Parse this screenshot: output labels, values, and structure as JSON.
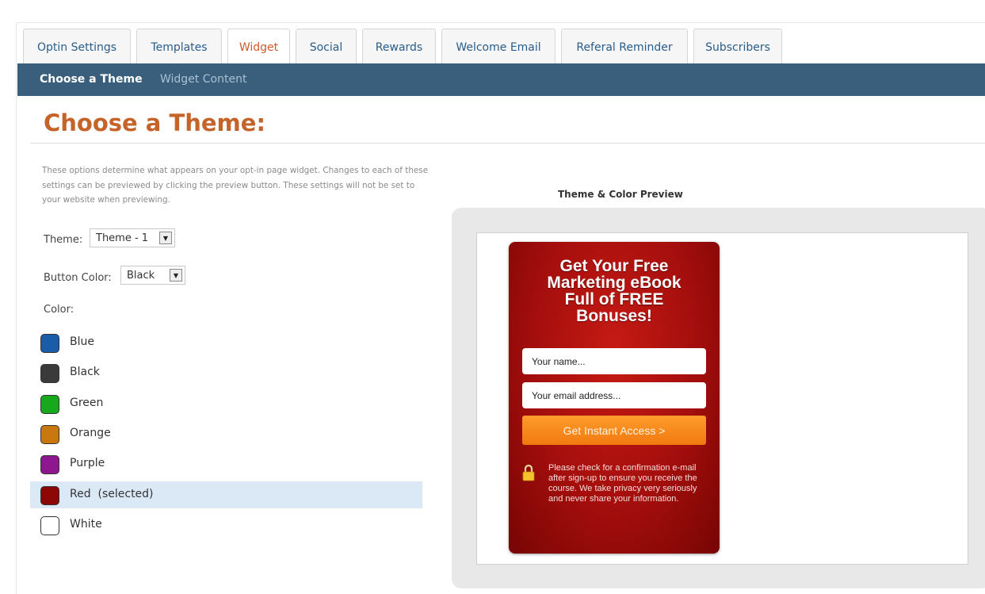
{
  "tabs": [
    {
      "label": "Optin Settings",
      "active": false
    },
    {
      "label": "Templates",
      "active": false
    },
    {
      "label": "Widget",
      "active": true
    },
    {
      "label": "Social",
      "active": false
    },
    {
      "label": "Rewards",
      "active": false
    },
    {
      "label": "Welcome Email",
      "active": false
    },
    {
      "label": "Referal Reminder",
      "active": false
    },
    {
      "label": "Subscribers",
      "active": false
    }
  ],
  "subnav": {
    "items": [
      {
        "label": "Choose a Theme",
        "active": true
      },
      {
        "label": "Widget Content",
        "active": false
      }
    ]
  },
  "page": {
    "title": "Choose a Theme:",
    "description": "These options determine what appears on your opt-in page widget. Changes to each of these settings can be previewed by clicking the preview button. These settings will not be set to your website when previewing."
  },
  "form": {
    "theme_label": "Theme:",
    "theme_value": "Theme - 1",
    "button_color_label": "Button Color:",
    "button_color_value": "Black",
    "color_label": "Color:"
  },
  "colors": [
    {
      "name": "Blue",
      "hex": "#1a5ca8",
      "selected": false
    },
    {
      "name": "Black",
      "hex": "#3a3a3a",
      "selected": false
    },
    {
      "name": "Green",
      "hex": "#17a81d",
      "selected": false
    },
    {
      "name": "Orange",
      "hex": "#c9770f",
      "selected": false
    },
    {
      "name": "Purple",
      "hex": "#8e168e",
      "selected": false
    },
    {
      "name": "Red  (selected)",
      "hex": "#8e0707",
      "selected": true
    },
    {
      "name": "White",
      "hex": "#ffffff",
      "selected": false
    }
  ],
  "preview": {
    "title": "Theme & Color Preview",
    "widget": {
      "headline": [
        "Get Your Free",
        "Marketing eBook",
        "Full of FREE",
        "Bonuses!"
      ],
      "name_placeholder": "Your name...",
      "email_placeholder": "Your email address...",
      "button_label": "Get Instant Access >",
      "privacy_text": "Please check for a confirmation e-mail after sign-up to ensure you receive the course. We take privacy very seriously and never share your information.",
      "lock_icon": "lock-icon"
    }
  },
  "accent": {
    "title": "#c4632a",
    "nav": "#3a5f7d",
    "tab_text": "#2a5d8a",
    "active_tab_text": "#cc5a2e"
  }
}
